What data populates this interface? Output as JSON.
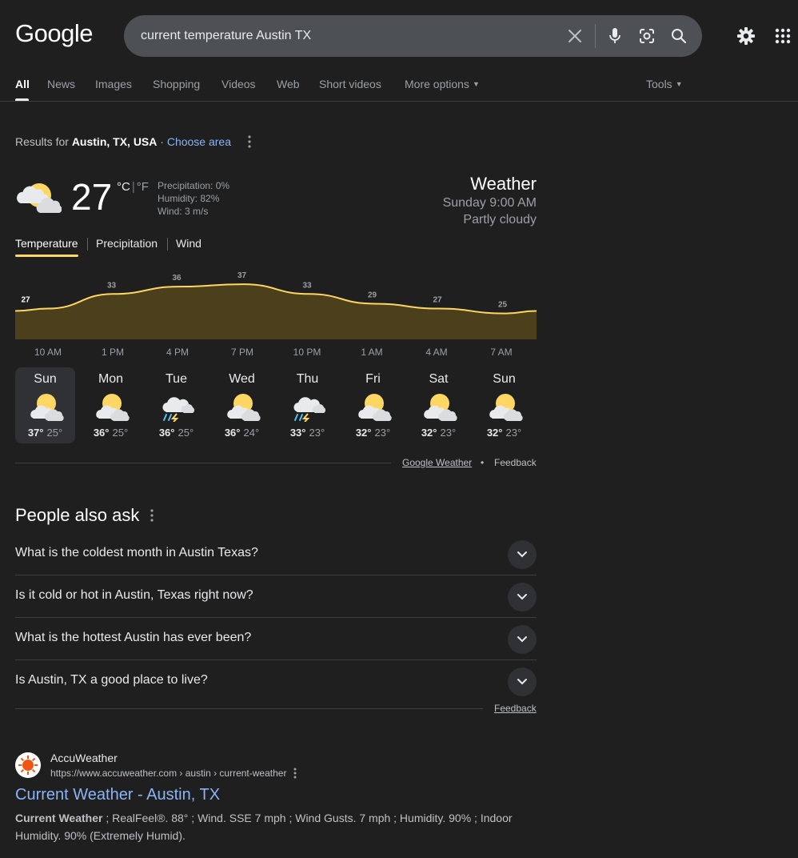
{
  "header": {
    "logo": "Google",
    "search_query": "current temperature Austin TX"
  },
  "tabs": [
    {
      "label": "All",
      "active": true
    },
    {
      "label": "News"
    },
    {
      "label": "Images"
    },
    {
      "label": "Shopping"
    },
    {
      "label": "Videos"
    },
    {
      "label": "Web"
    },
    {
      "label": "Short videos"
    },
    {
      "label": "More options"
    },
    {
      "label": "Tools"
    }
  ],
  "results_for": {
    "prefix": "Results for",
    "location": "Austin, TX, USA",
    "separator": "·",
    "choose_area": "Choose area"
  },
  "weather": {
    "current_temp": "27",
    "unit_c": "°C",
    "unit_sep": "|",
    "unit_f": "°F",
    "precipitation": "Precipitation: 0%",
    "humidity": "Humidity: 82%",
    "wind": "Wind: 3 m/s",
    "title": "Weather",
    "datetime": "Sunday 9:00 AM",
    "condition": "Partly cloudy",
    "condition_icon": "partly-cloudy-icon",
    "tabs": [
      "Temperature",
      "Precipitation",
      "Wind"
    ],
    "accent_color": "#fdd663",
    "hourly_labels": [
      "10 AM",
      "1 PM",
      "4 PM",
      "7 PM",
      "10 PM",
      "1 AM",
      "4 AM",
      "7 AM"
    ],
    "forecast": [
      {
        "day": "Sun",
        "hi": "37°",
        "lo": "25°",
        "icon": "partly-cloudy-icon",
        "selected": true
      },
      {
        "day": "Mon",
        "hi": "36°",
        "lo": "25°",
        "icon": "partly-cloudy-icon"
      },
      {
        "day": "Tue",
        "hi": "36°",
        "lo": "25°",
        "icon": "thunderstorm-rain-icon"
      },
      {
        "day": "Wed",
        "hi": "36°",
        "lo": "24°",
        "icon": "partly-cloudy-icon"
      },
      {
        "day": "Thu",
        "hi": "33°",
        "lo": "23°",
        "icon": "thunderstorm-rain-icon"
      },
      {
        "day": "Fri",
        "hi": "32°",
        "lo": "23°",
        "icon": "partly-cloudy-icon"
      },
      {
        "day": "Sat",
        "hi": "32°",
        "lo": "23°",
        "icon": "partly-cloudy-icon"
      },
      {
        "day": "Sun",
        "hi": "32°",
        "lo": "23°",
        "icon": "partly-cloudy-icon"
      }
    ],
    "source_link": "Google Weather",
    "footer_sep": "•",
    "feedback": "Feedback"
  },
  "chart_data": {
    "type": "area",
    "x": [
      "10 AM",
      "1 PM",
      "4 PM",
      "7 PM",
      "10 PM",
      "1 AM",
      "4 AM",
      "7 AM"
    ],
    "values": [
      27,
      33,
      36,
      37,
      33,
      29,
      27,
      25
    ],
    "series_color": "#fdd663",
    "fill_color": "#4b3f1c",
    "ylim": [
      15,
      40
    ]
  },
  "people_also_ask": {
    "title": "People also ask",
    "questions": [
      "What is the coldest month in Austin Texas?",
      "Is it cold or hot in Austin, Texas right now?",
      "What is the hottest Austin has ever been?",
      "Is Austin, TX a good place to live?"
    ],
    "feedback": "Feedback"
  },
  "result": {
    "site_name": "AccuWeather",
    "url": "https://www.accuweather.com › austin › current-weather",
    "title": "Current Weather - Austin, TX",
    "snippet_bold": "Current Weather",
    "snippet_rest": " ; RealFeel®. 88° ; Wind. SSE 7 mph ; Wind Gusts. 7 mph ; Humidity. 90% ; Indoor Humidity. 90% (Extremely Humid)."
  }
}
